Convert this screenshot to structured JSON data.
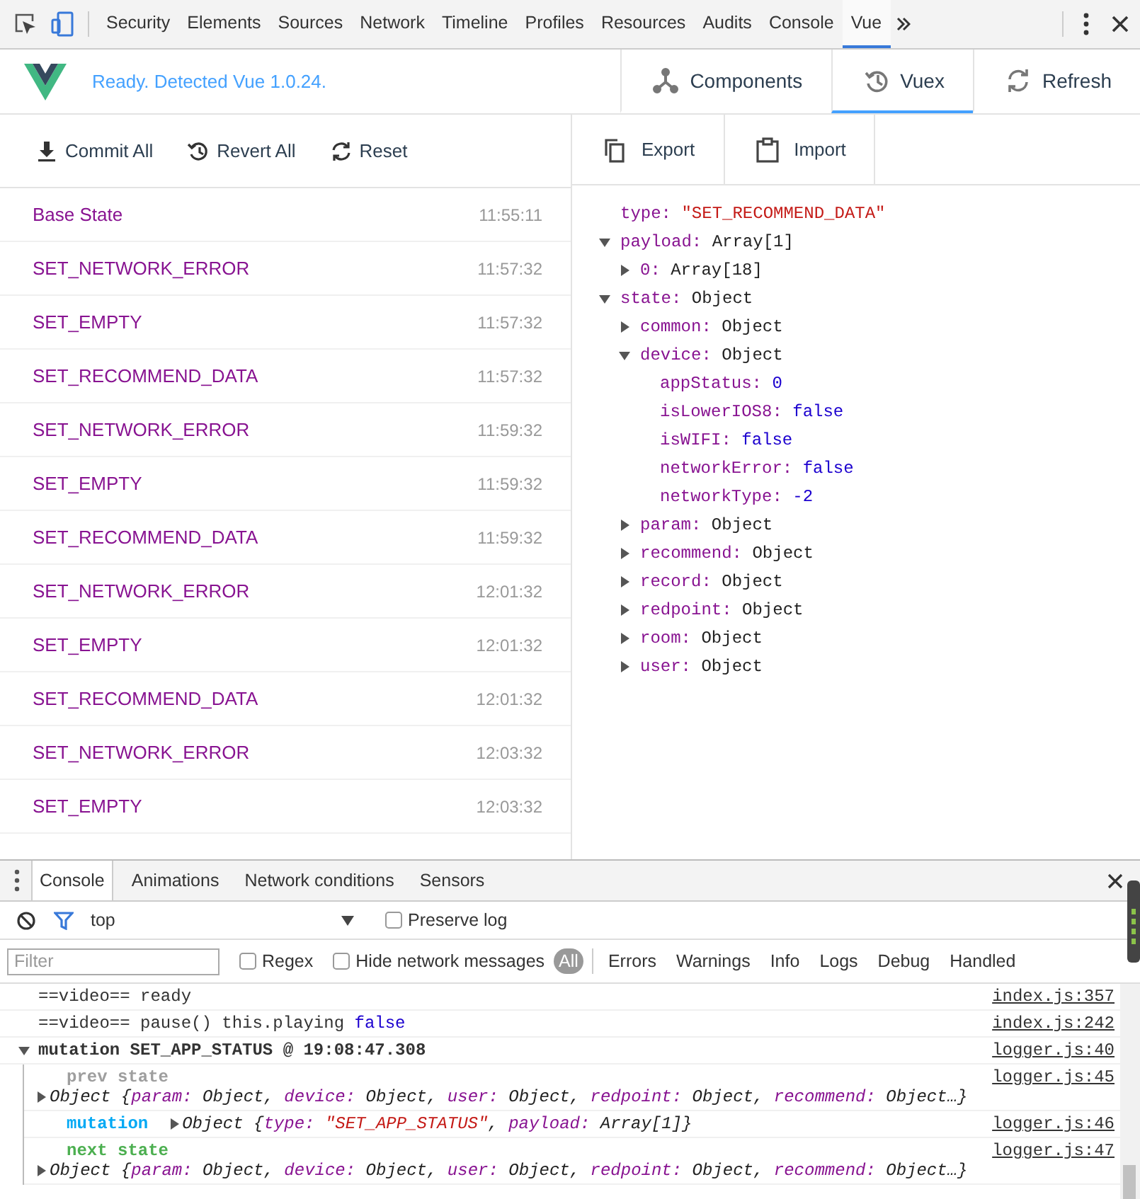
{
  "devtools_tabs": [
    {
      "label": "Security",
      "selected": false
    },
    {
      "label": "Elements",
      "selected": false
    },
    {
      "label": "Sources",
      "selected": false
    },
    {
      "label": "Network",
      "selected": false
    },
    {
      "label": "Timeline",
      "selected": false
    },
    {
      "label": "Profiles",
      "selected": false
    },
    {
      "label": "Resources",
      "selected": false
    },
    {
      "label": "Audits",
      "selected": false
    },
    {
      "label": "Console",
      "selected": false
    },
    {
      "label": "Vue",
      "selected": true
    }
  ],
  "vue_header": {
    "status": "Ready. Detected Vue 1.0.24.",
    "tabs": [
      {
        "label": "Components",
        "selected": false
      },
      {
        "label": "Vuex",
        "selected": true
      },
      {
        "label": "Refresh",
        "selected": false
      }
    ]
  },
  "mutation_toolbar": [
    "Commit All",
    "Revert All",
    "Reset"
  ],
  "mutations": [
    {
      "name": "Base State",
      "time": "11:55:11"
    },
    {
      "name": "SET_NETWORK_ERROR",
      "time": "11:57:32"
    },
    {
      "name": "SET_EMPTY",
      "time": "11:57:32"
    },
    {
      "name": "SET_RECOMMEND_DATA",
      "time": "11:57:32"
    },
    {
      "name": "SET_NETWORK_ERROR",
      "time": "11:59:32"
    },
    {
      "name": "SET_EMPTY",
      "time": "11:59:32"
    },
    {
      "name": "SET_RECOMMEND_DATA",
      "time": "11:59:32"
    },
    {
      "name": "SET_NETWORK_ERROR",
      "time": "12:01:32"
    },
    {
      "name": "SET_EMPTY",
      "time": "12:01:32"
    },
    {
      "name": "SET_RECOMMEND_DATA",
      "time": "12:01:32"
    },
    {
      "name": "SET_NETWORK_ERROR",
      "time": "12:03:32"
    },
    {
      "name": "SET_EMPTY",
      "time": "12:03:32"
    }
  ],
  "state_toolbar": [
    "Export",
    "Import"
  ],
  "state_tree": [
    {
      "kind": "string",
      "key": "type:",
      "value": "\"SET_RECOMMEND_DATA\""
    },
    {
      "kind": "node",
      "key": "payload:",
      "value": "Array[1]",
      "expanded": true,
      "children": [
        {
          "kind": "node",
          "key": "0:",
          "value": "Array[18]",
          "expanded": false
        }
      ]
    },
    {
      "kind": "node",
      "key": "state:",
      "value": "Object",
      "expanded": true,
      "children": [
        {
          "kind": "node",
          "key": "common:",
          "value": "Object",
          "expanded": false
        },
        {
          "kind": "node",
          "key": "device:",
          "value": "Object",
          "expanded": true,
          "children": [
            {
              "kind": "literal",
              "key": "appStatus:",
              "value": "0"
            },
            {
              "kind": "literal",
              "key": "isLowerIOS8:",
              "value": "false"
            },
            {
              "kind": "literal",
              "key": "isWIFI:",
              "value": "false"
            },
            {
              "kind": "literal",
              "key": "networkError:",
              "value": "false"
            },
            {
              "kind": "literal",
              "key": "networkType:",
              "value": "-2"
            }
          ]
        },
        {
          "kind": "node",
          "key": "param:",
          "value": "Object",
          "expanded": false
        },
        {
          "kind": "node",
          "key": "recommend:",
          "value": "Object",
          "expanded": false
        },
        {
          "kind": "node",
          "key": "record:",
          "value": "Object",
          "expanded": false
        },
        {
          "kind": "node",
          "key": "redpoint:",
          "value": "Object",
          "expanded": false
        },
        {
          "kind": "node",
          "key": "room:",
          "value": "Object",
          "expanded": false
        },
        {
          "kind": "node",
          "key": "user:",
          "value": "Object",
          "expanded": false
        }
      ]
    }
  ],
  "drawer": {
    "tabs": [
      {
        "label": "Console",
        "selected": true
      },
      {
        "label": "Animations",
        "selected": false
      },
      {
        "label": "Network conditions",
        "selected": false
      },
      {
        "label": "Sensors",
        "selected": false
      }
    ],
    "context": "top",
    "preserve_log": {
      "label": "Preserve log",
      "checked": false
    },
    "filter": {
      "placeholder": "Filter"
    },
    "options": [
      {
        "label": "Regex",
        "checked": false
      },
      {
        "label": "Hide network messages",
        "checked": false
      }
    ],
    "levels": [
      {
        "label": "All",
        "selected": true
      },
      {
        "label": "Errors",
        "selected": false
      },
      {
        "label": "Warnings",
        "selected": false
      },
      {
        "label": "Info",
        "selected": false
      },
      {
        "label": "Logs",
        "selected": false
      },
      {
        "label": "Debug",
        "selected": false
      },
      {
        "label": "Handled",
        "selected": false
      }
    ],
    "lines": [
      {
        "kind": "log",
        "parts": [
          {
            "text": "==video== ready",
            "kind": "plain"
          }
        ],
        "source": "index.js:357"
      },
      {
        "kind": "log",
        "parts": [
          {
            "text": "==video== pause() this.playing ",
            "kind": "plain"
          },
          {
            "text": "false",
            "kind": "keyword"
          }
        ],
        "source": "index.js:242"
      },
      {
        "kind": "group",
        "expanded": true,
        "title": "mutation SET_APP_STATUS @ 19:08:47.308",
        "source": "logger.js:40",
        "children": [
          {
            "label": "prev state",
            "color": "#9e9e9e",
            "kind": "stacked",
            "source": "logger.js:45",
            "object": {
              "type": "Object",
              "open": "{",
              "close": "}",
              "expanded": false,
              "props": [
                {
                  "key": "param:",
                  "value": "Object",
                  "kind": "object",
                  "sep": ","
                },
                {
                  "key": "device:",
                  "value": "Object",
                  "kind": "object",
                  "sep": ","
                },
                {
                  "key": "user:",
                  "value": "Object",
                  "kind": "object",
                  "sep": ","
                },
                {
                  "key": "redpoint:",
                  "value": "Object",
                  "kind": "object",
                  "sep": ","
                },
                {
                  "key": "recommend:",
                  "value": "Object…",
                  "kind": "object"
                }
              ]
            }
          },
          {
            "label": "mutation",
            "color": "#03a9f4",
            "kind": "inline",
            "source": "logger.js:46",
            "object": {
              "type": "Object",
              "open": "{",
              "close": "}",
              "expanded": false,
              "props": [
                {
                  "key": "type:",
                  "value": "\"SET_APP_STATUS\"",
                  "kind": "string",
                  "sep": ","
                },
                {
                  "key": "payload:",
                  "value": "Array[1]",
                  "kind": "object"
                }
              ]
            }
          },
          {
            "label": "next state",
            "color": "#4caf50",
            "kind": "stacked",
            "source": "logger.js:47",
            "object": {
              "type": "Object",
              "open": "{",
              "close": "}",
              "expanded": false,
              "props": [
                {
                  "key": "param:",
                  "value": "Object",
                  "kind": "object",
                  "sep": ","
                },
                {
                  "key": "device:",
                  "value": "Object",
                  "kind": "object",
                  "sep": ","
                },
                {
                  "key": "user:",
                  "value": "Object",
                  "kind": "object",
                  "sep": ","
                },
                {
                  "key": "redpoint:",
                  "value": "Object",
                  "kind": "object",
                  "sep": ","
                },
                {
                  "key": "recommend:",
                  "value": "Object…",
                  "kind": "object"
                }
              ]
            }
          }
        ]
      }
    ]
  }
}
